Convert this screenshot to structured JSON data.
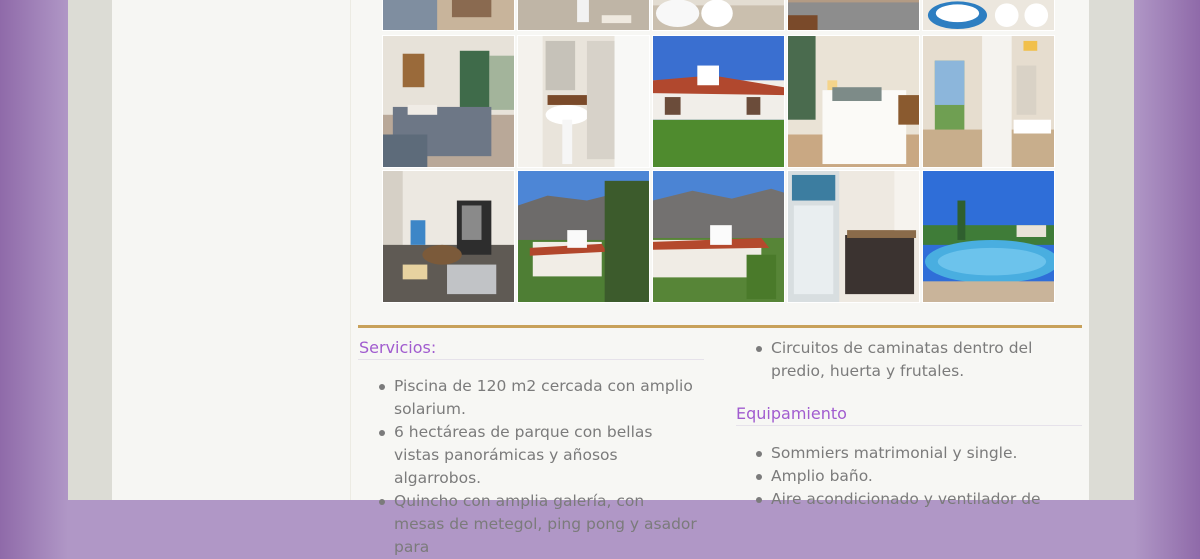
{
  "colors": {
    "page_edge": "#8f6aa9",
    "page_bg": "#b097c6",
    "frame": "#dcdcd5",
    "content_bg": "#f7f7f4",
    "gold_rule": "#c8a15a",
    "heading": "#a15ccf",
    "text": "#7b7b7b"
  },
  "gallery": {
    "photos": [
      "bedroom-photo",
      "bathroom-photo",
      "bathroom-toilet-photo",
      "bedroom-detail-photo",
      "bathroom-photo",
      "bedroom-twin-photo",
      "bathroom-shower-photo",
      "building-exterior-photo",
      "bedroom-double-photo",
      "room-interior-photo",
      "kitchenette-photo",
      "building-mountains-photo",
      "building-mountains-photo",
      "kitchen-fridge-photo",
      "pool-photo"
    ]
  },
  "servicios": {
    "title": "Servicios:",
    "items": [
      "Piscina de 120 m2 cercada con amplio solarium.",
      "6 hectáreas de parque con bellas vistas panorámicas y añosos algarrobos.",
      "Quincho con amplia galería, con mesas de metegol, ping pong y asador para"
    ]
  },
  "servicios_cont": {
    "items": [
      "Circuitos de caminatas dentro del predio, huerta y frutales."
    ]
  },
  "equipamiento": {
    "title": "Equipamiento",
    "items": [
      "Sommiers matrimonial y single.",
      "Amplio baño.",
      "Aire acondicionado y ventilador de"
    ]
  }
}
